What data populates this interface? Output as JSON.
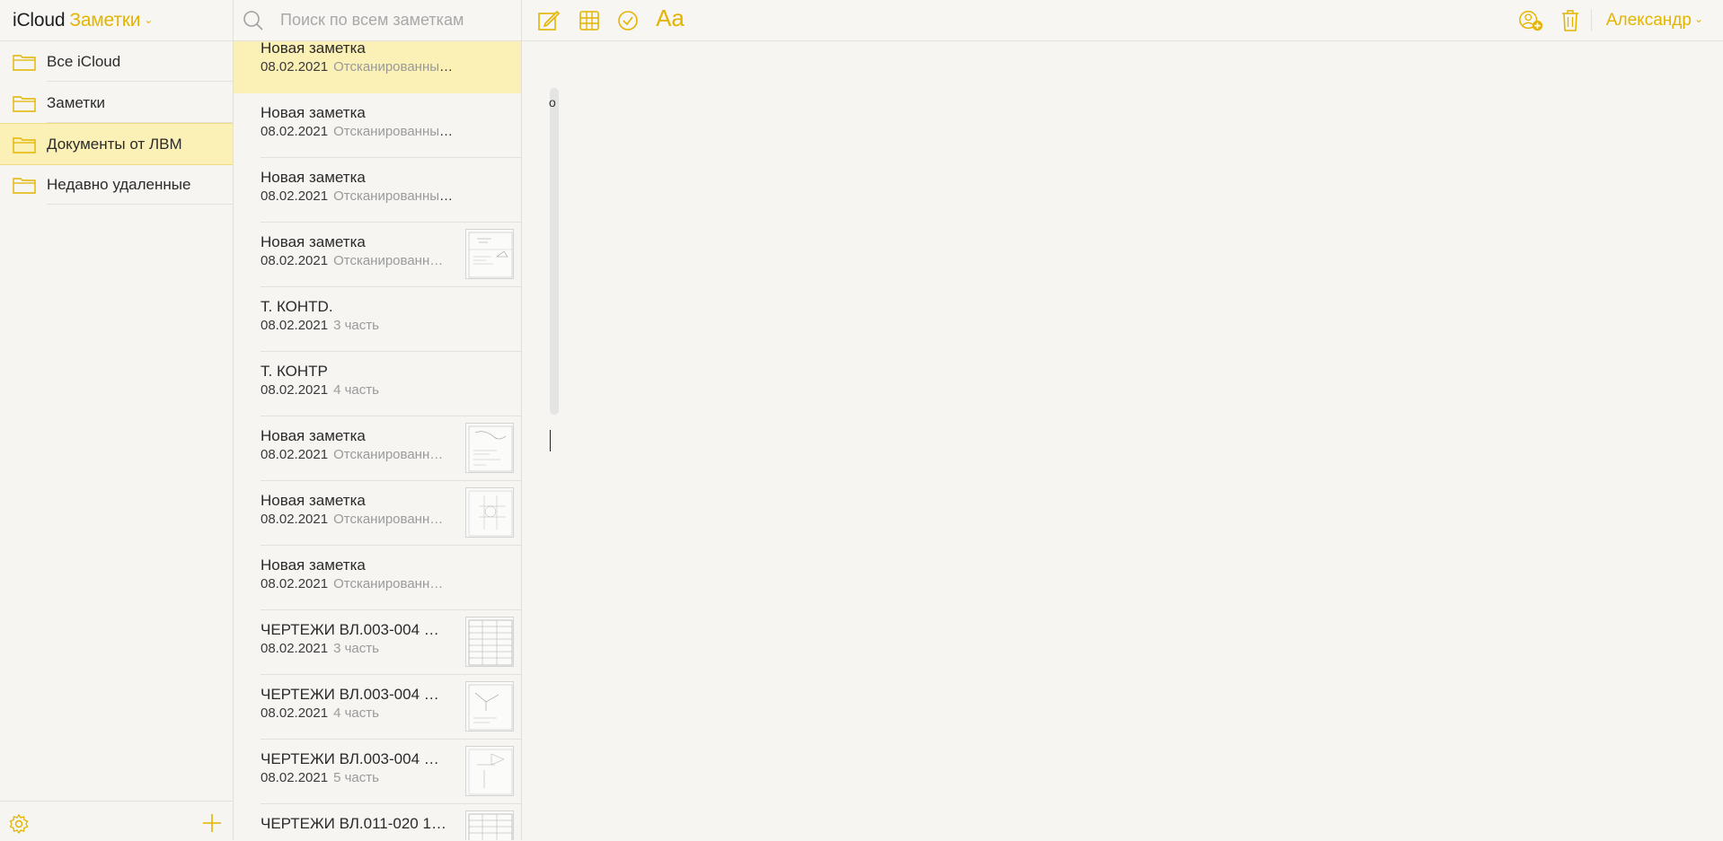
{
  "header": {
    "brand_icloud": "iCloud",
    "brand_app": "Заметки",
    "user": "Александр"
  },
  "search": {
    "placeholder": "Поиск по всем заметкам"
  },
  "toolbar": {
    "items": [
      "compose-icon",
      "table-icon",
      "checklist-icon",
      "format-text-button"
    ],
    "format_label": "Aa",
    "right_items": [
      "add-person-icon",
      "trash-icon"
    ]
  },
  "accent_color": "#e4b400",
  "selection_color": "#fbf0b5",
  "folders": [
    {
      "label": "Все iCloud",
      "selected": false
    },
    {
      "label": "Заметки",
      "selected": false
    },
    {
      "label": "Документы от ЛВМ",
      "selected": true
    },
    {
      "label": "Недавно удаленные",
      "selected": false
    }
  ],
  "notes": [
    {
      "title": "Новая заметка",
      "date": "08.02.2021",
      "snippet": "Отсканированных док…",
      "thumb": false,
      "selected": true
    },
    {
      "title": "Новая заметка",
      "date": "08.02.2021",
      "snippet": "Отсканированных док…",
      "thumb": false
    },
    {
      "title": "Новая заметка",
      "date": "08.02.2021",
      "snippet": "Отсканированных док…",
      "thumb": false
    },
    {
      "title": "Новая заметка",
      "date": "08.02.2021",
      "snippet": "Отсканированн…",
      "thumb": true
    },
    {
      "title": "Т. КОНТD.",
      "date": "08.02.2021",
      "snippet": "3 часть",
      "thumb": false
    },
    {
      "title": "Т. КОНТР",
      "date": "08.02.2021",
      "snippet": "4 часть",
      "thumb": false
    },
    {
      "title": "Новая заметка",
      "date": "08.02.2021",
      "snippet": "Отсканированн…",
      "thumb": true
    },
    {
      "title": "Новая заметка",
      "date": "08.02.2021",
      "snippet": "Отсканированн…",
      "thumb": true
    },
    {
      "title": "Новая заметка",
      "date": "08.02.2021",
      "snippet": "Отсканированн…",
      "thumb": false
    },
    {
      "title": "ЧЕРТЕЖИ ВЛ.003-004 …",
      "date": "08.02.2021",
      "snippet": "3 часть",
      "thumb": true
    },
    {
      "title": "ЧЕРТЕЖИ ВЛ.003-004 …",
      "date": "08.02.2021",
      "snippet": "4 часть",
      "thumb": true
    },
    {
      "title": "ЧЕРТЕЖИ ВЛ.003-004 …",
      "date": "08.02.2021",
      "snippet": "5 часть",
      "thumb": true
    },
    {
      "title": "ЧЕРТЕЖИ ВЛ.011-020 1…",
      "date": "",
      "snippet": "",
      "thumb": true
    }
  ],
  "editor": {
    "scroll_char": "o"
  },
  "footer": {
    "icons": [
      "settings-icon",
      "add-folder-icon"
    ]
  }
}
